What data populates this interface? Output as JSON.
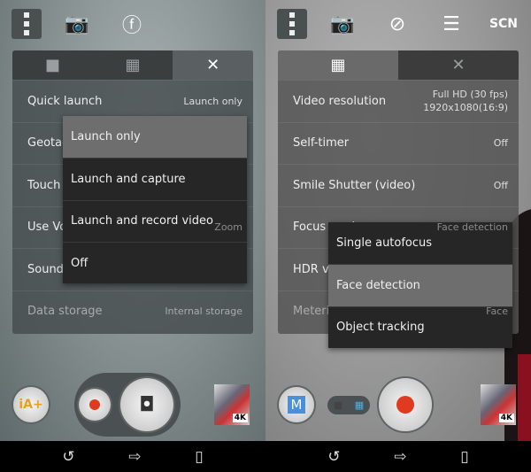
{
  "left": {
    "toolbar": {
      "menu": "menu-icon",
      "icons": [
        "switch-camera-icon",
        "flash-auto-icon"
      ]
    },
    "tabs": [
      {
        "icon": "camera-icon",
        "selected": false
      },
      {
        "icon": "video-icon",
        "selected": false
      },
      {
        "icon": "wrench-icon",
        "selected": true
      }
    ],
    "rows": [
      {
        "label": "Quick launch",
        "value": "Launch only"
      },
      {
        "label": "Geotagging",
        "toggle": "off"
      },
      {
        "label": "Touch capture",
        "toggle": "off"
      },
      {
        "label": "Use Volume key as",
        "value": "Zoom"
      },
      {
        "label": "Sound",
        "toggle": "on"
      },
      {
        "label": "Data storage",
        "value": "Internal storage"
      }
    ],
    "dropdown": {
      "options": [
        "Launch only",
        "Launch and capture",
        "Launch and record video",
        "Off"
      ],
      "selected": "Launch only"
    },
    "controls": {
      "mode": "iA+",
      "thumb_badge": "4K"
    }
  },
  "right": {
    "toolbar": {
      "menu": "menu-icon",
      "icons": [
        "switch-camera-icon",
        "flash-off-icon",
        "sliders-icon"
      ],
      "scene": "SCN"
    },
    "tabs": [
      {
        "icon": "video-icon",
        "selected": true
      },
      {
        "icon": "wrench-icon",
        "selected": false
      }
    ],
    "rows": [
      {
        "label": "Video resolution",
        "value": "Full HD (30 fps)",
        "value2": "1920x1080(16:9)"
      },
      {
        "label": "Self-timer",
        "value": "Off"
      },
      {
        "label": "Smile Shutter (video)",
        "value": "Off"
      },
      {
        "label": "Focus mode",
        "value": "Face detection"
      },
      {
        "label": "HDR video",
        "toggle": "off"
      },
      {
        "label": "Metering",
        "value": "Face"
      }
    ],
    "dropdown": {
      "options": [
        "Single autofocus",
        "Face detection",
        "Object tracking"
      ],
      "selected": "Face detection"
    },
    "controls": {
      "mode": "M",
      "thumb_badge": "4K"
    }
  },
  "nav": {
    "icons": [
      "back-icon",
      "home-icon",
      "recent-apps-icon"
    ]
  },
  "colors": {
    "record": "#e03a20",
    "accent_blue": "#4a90d9",
    "ia_orange": "#e8a020"
  }
}
